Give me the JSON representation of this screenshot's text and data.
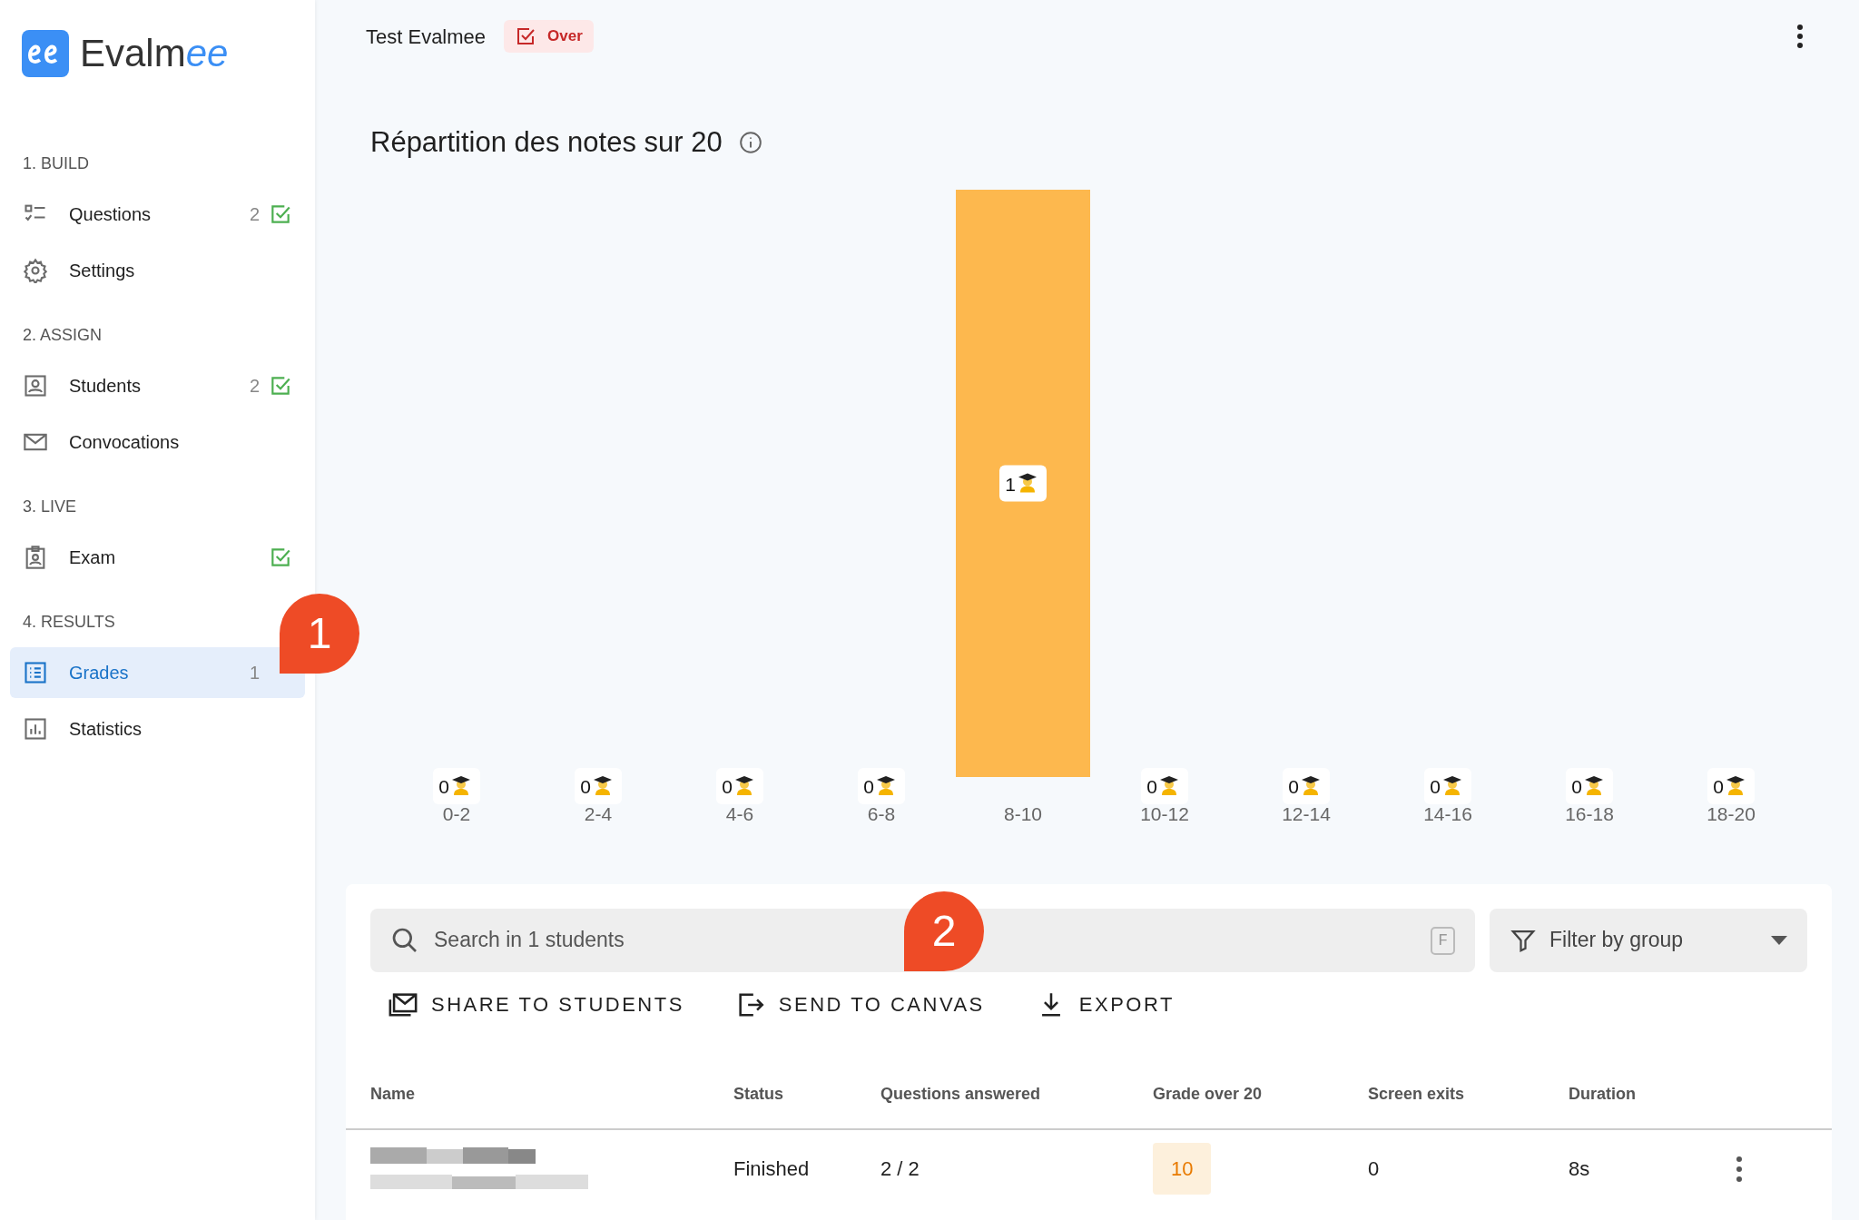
{
  "logo": {
    "text": "Evalm",
    "accent": "ee"
  },
  "sidebar": {
    "sections": [
      {
        "title": "1. BUILD",
        "items": [
          {
            "label": "Questions",
            "kind": "list",
            "count": "2",
            "done": true,
            "selected": false
          },
          {
            "label": "Settings",
            "kind": "gear",
            "done": false,
            "selected": false
          }
        ]
      },
      {
        "title": "2. ASSIGN",
        "items": [
          {
            "label": "Students",
            "kind": "person",
            "count": "2",
            "done": true,
            "selected": false
          },
          {
            "label": "Convocations",
            "kind": "mail",
            "done": false,
            "selected": false
          }
        ]
      },
      {
        "title": "3. LIVE",
        "items": [
          {
            "label": "Exam",
            "kind": "clipboard",
            "done": true,
            "selected": false
          }
        ]
      },
      {
        "title": "4. RESULTS",
        "items": [
          {
            "label": "Grades",
            "kind": "table",
            "count": "1",
            "done": false,
            "selected": true
          },
          {
            "label": "Statistics",
            "kind": "chart",
            "done": false,
            "selected": false
          }
        ]
      }
    ]
  },
  "header": {
    "title": "Test Evalmee",
    "status": "Over"
  },
  "chart": {
    "title": "Répartition des notes sur 20",
    "chart_data": {
      "type": "bar",
      "categories": [
        "0-2",
        "2-4",
        "4-6",
        "6-8",
        "8-10",
        "10-12",
        "12-14",
        "14-16",
        "16-18",
        "18-20"
      ],
      "series": [
        {
          "color": "#fdb84e",
          "values": [
            0,
            0,
            0,
            0,
            1,
            0,
            0,
            0,
            0,
            0
          ]
        }
      ],
      "data_labels": true
    }
  },
  "search": {
    "placeholder": "Search in 1 students",
    "shortcut": "F"
  },
  "filter": {
    "label": "Filter by group"
  },
  "actions": [
    {
      "label": "SHARE TO STUDENTS",
      "kind": "share"
    },
    {
      "label": "SEND TO CANVAS",
      "kind": "send"
    },
    {
      "label": "EXPORT",
      "kind": "download"
    }
  ],
  "table": {
    "columns": [
      "Name",
      "Status",
      "Questions answered",
      "Grade over 20",
      "Screen exits",
      "Duration"
    ],
    "rows": [
      {
        "status": "Finished",
        "answered": "2 / 2",
        "grade": "10",
        "exits": "0",
        "duration": "8s"
      }
    ]
  },
  "callouts": [
    {
      "label": "1"
    },
    {
      "label": "2"
    }
  ]
}
